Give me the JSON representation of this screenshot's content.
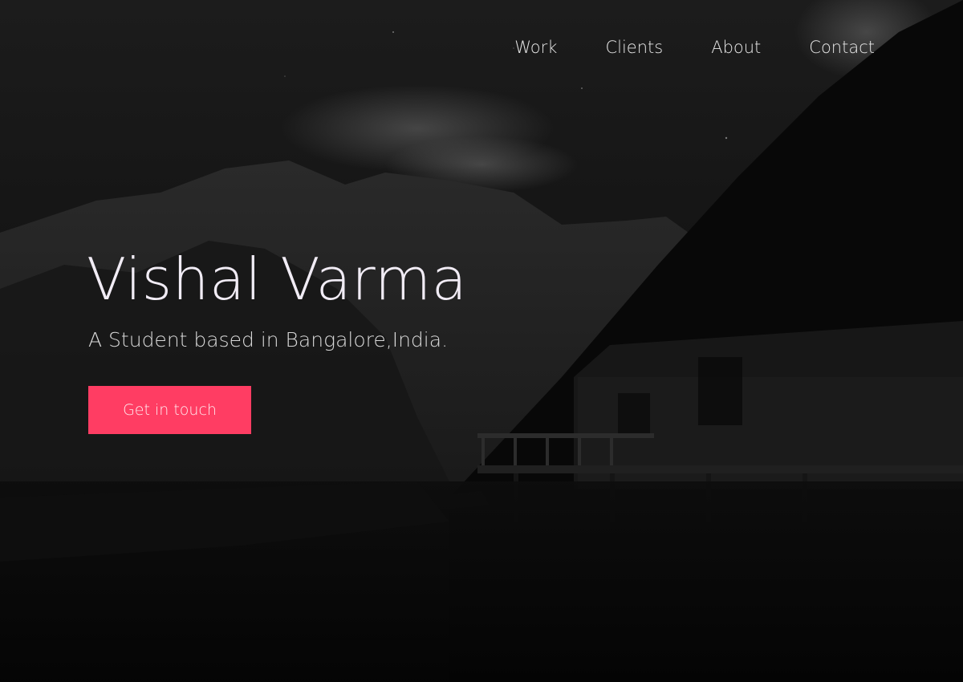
{
  "nav": {
    "items": [
      {
        "label": "Work"
      },
      {
        "label": "Clients"
      },
      {
        "label": "About"
      },
      {
        "label": "Contact"
      }
    ]
  },
  "hero": {
    "name": "Vishal Varma",
    "tagline": "A Student based in Bangalore,India.",
    "cta_label": "Get in touch",
    "accent_color": "#ff3d63",
    "background_image": "dark-mountain-lake-cabin"
  }
}
